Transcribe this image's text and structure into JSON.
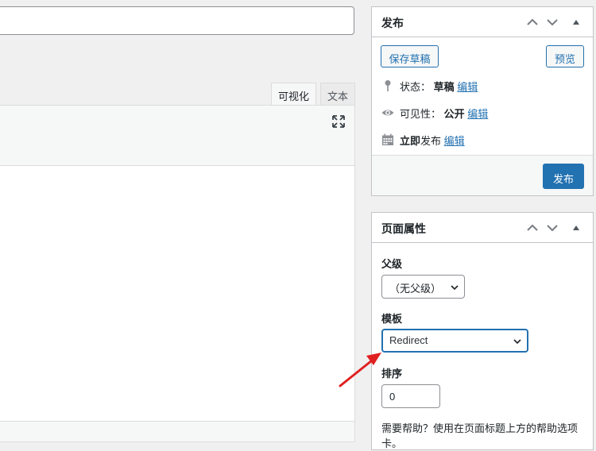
{
  "editor": {
    "tabs": [
      "可视化",
      "文本"
    ]
  },
  "publish_box": {
    "title": "发布",
    "save_draft": "保存草稿",
    "preview": "预览",
    "status_label": "状态：",
    "status_value": "草稿",
    "visibility_label": "可见性：",
    "visibility_value": "公开",
    "schedule_strong": "立即",
    "schedule_label": "发布",
    "edit_link": "编辑",
    "publish_button": "发布"
  },
  "page_attributes": {
    "title": "页面属性",
    "parent_label": "父级",
    "parent_value": "（无父级）",
    "template_label": "模板",
    "template_value": "Redirect",
    "order_label": "排序",
    "order_value": "0",
    "help_text": "需要帮助？使用在页面标题上方的帮助选项卡。"
  },
  "icons": {
    "fullscreen": "fullscreen-icon",
    "move_up": "chevron-up-icon",
    "move_down": "chevron-down-icon",
    "toggle": "triangle-up-icon",
    "status": "pin-icon",
    "visibility": "eye-icon",
    "schedule": "calendar-icon"
  },
  "colors": {
    "accent": "#2271b1",
    "annotation_arrow": "#e02020",
    "background": "#f0f0f1"
  }
}
